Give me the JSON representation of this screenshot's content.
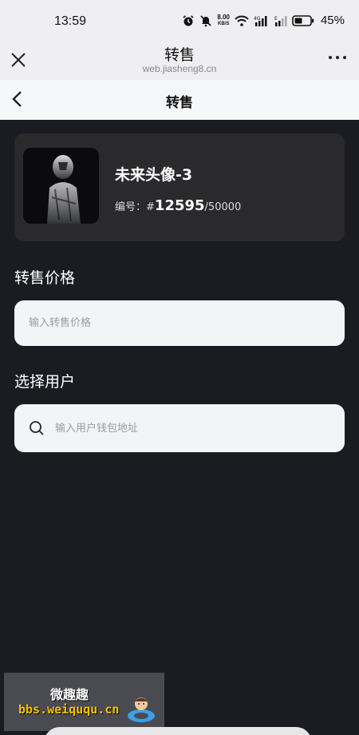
{
  "status_bar": {
    "time": "13:59",
    "net_speed_value": "8.00",
    "net_speed_unit": "KB/S",
    "battery_percent": "45%",
    "icons": [
      "alarm-icon",
      "mute-icon",
      "wifi-icon",
      "signal-4g-icon",
      "signal-e-icon",
      "battery-icon"
    ]
  },
  "browser": {
    "title": "转售",
    "url": "web.jiasheng8.cn"
  },
  "header": {
    "title": "转售"
  },
  "nft": {
    "name": "未来头像-3",
    "serial_label": "编号：",
    "serial_prefix": "#",
    "serial_number": "12595",
    "serial_total": "/50000"
  },
  "form": {
    "price_label": "转售价格",
    "price_placeholder": "输入转售价格",
    "user_label": "选择用户",
    "user_placeholder": "输入用户钱包地址"
  },
  "watermark": {
    "title": "微趣趣",
    "url": "bbs.weiququ.cn"
  },
  "colors": {
    "page_background": "#1b1c21",
    "card_background": "#2a2a2d",
    "input_background": "#f3f4f6",
    "watermark_accent": "#f5c400"
  }
}
